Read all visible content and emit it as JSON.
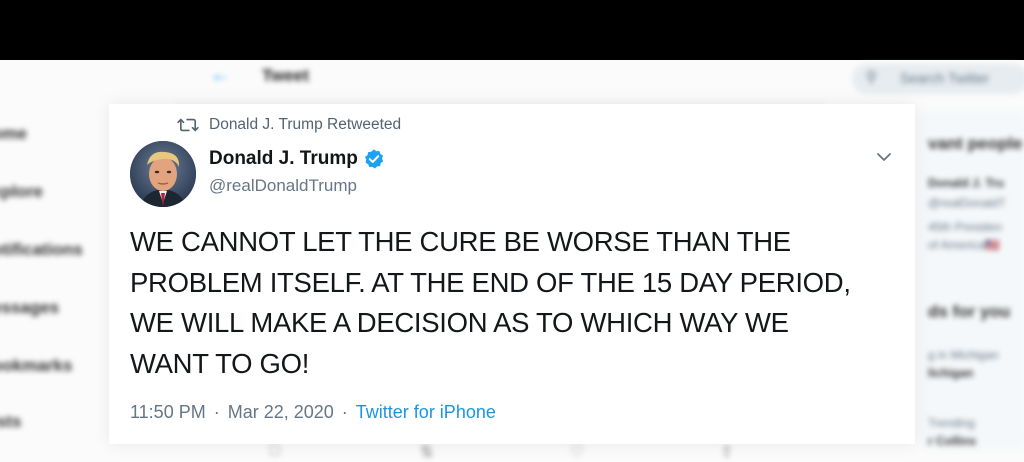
{
  "background": {
    "header_title": "Tweet",
    "search_placeholder": "Search Twitter",
    "nav_items": [
      "ome",
      "xplore",
      "otifications",
      "essages",
      "ookmarks",
      "ists"
    ],
    "right_panel": {
      "who_to_follow_title": "vant people",
      "person_name": "Donald J. Tru",
      "person_handle": "@realDonaldT",
      "person_bio_1": "45th Presiden",
      "person_bio_2": "of America🇺🇸",
      "trends_title": "ds for you",
      "trend_1_context": "g in Michigan",
      "trend_1_name": "lichigan",
      "trend_2_context": "Trending",
      "trend_2_name": "r Collins"
    }
  },
  "tweet": {
    "retweeted_by": "Donald J. Trump Retweeted",
    "author_name": "Donald J. Trump",
    "author_handle": "@realDonaldTrump",
    "text": "WE CANNOT LET THE CURE BE WORSE THAN THE\nPROBLEM ITSELF. AT THE END OF THE 15 DAY PERIOD,\nWE WILL MAKE A DECISION AS TO WHICH WAY WE\nWANT TO GO!",
    "time": "11:50 PM",
    "separator": "·",
    "date": "Mar 22, 2020",
    "source": "Twitter for iPhone"
  },
  "colors": {
    "link_blue": "#1b95e0",
    "verified_blue": "#1da1f2",
    "secondary_text": "#657786"
  },
  "icons": {
    "retweet": "retweet-icon",
    "verified": "verified-badge-icon",
    "caret": "chevron-down-icon",
    "back": "back-arrow-icon",
    "search": "search-icon"
  }
}
